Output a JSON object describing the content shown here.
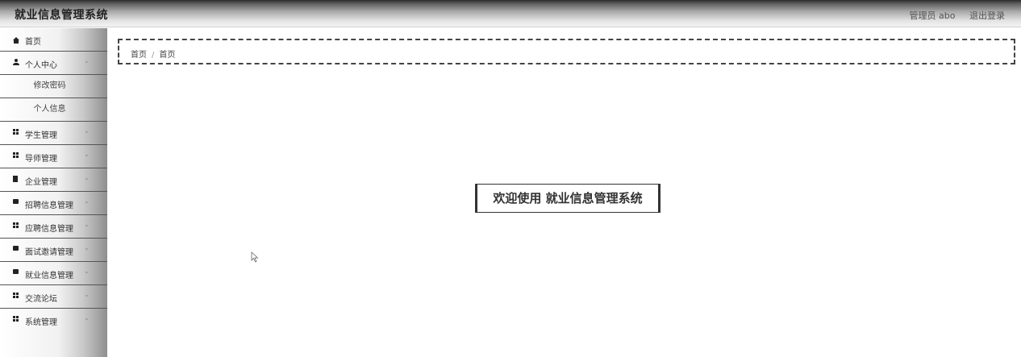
{
  "header": {
    "title": "就业信息管理系统",
    "user_label": "管理员 abo",
    "logout_label": "退出登录"
  },
  "sidebar": {
    "items": [
      {
        "label": "首页",
        "icon": "home-icon",
        "has_submenu": false
      },
      {
        "label": "个人中心",
        "icon": "user-icon",
        "has_submenu": true,
        "children": [
          {
            "label": "修改密码"
          },
          {
            "label": "个人信息"
          }
        ]
      },
      {
        "label": "学生管理",
        "icon": "grid-icon",
        "has_submenu": true
      },
      {
        "label": "导师管理",
        "icon": "grid-icon",
        "has_submenu": true
      },
      {
        "label": "企业管理",
        "icon": "doc-icon",
        "has_submenu": true
      },
      {
        "label": "招聘信息管理",
        "icon": "message-icon",
        "has_submenu": true
      },
      {
        "label": "应聘信息管理",
        "icon": "grid-icon",
        "has_submenu": true
      },
      {
        "label": "面试邀请管理",
        "icon": "message-icon",
        "has_submenu": true
      },
      {
        "label": "就业信息管理",
        "icon": "message-icon",
        "has_submenu": true
      },
      {
        "label": "交流论坛",
        "icon": "grid-icon",
        "has_submenu": true
      },
      {
        "label": "系统管理",
        "icon": "grid-icon",
        "has_submenu": true
      }
    ]
  },
  "breadcrumb": {
    "home": "首页",
    "separator": "/",
    "current": "首页"
  },
  "main": {
    "welcome_text": "欢迎使用 就业信息管理系统"
  }
}
